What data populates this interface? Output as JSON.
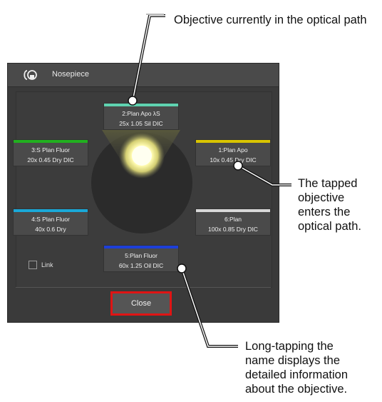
{
  "callouts": {
    "current": "Objective currently in the optical path",
    "tapped_1": "The tapped",
    "tapped_2": "objective",
    "tapped_3": "enters the",
    "tapped_4": "optical path.",
    "long_1": "Long-tapping the",
    "long_2": "name displays the",
    "long_3": "detailed information",
    "long_4": "about the objective."
  },
  "dialog": {
    "title": "Nosepiece",
    "icon": "nosepiece-app-icon",
    "link_label": "Link",
    "link_checked": false,
    "close_label": "Close"
  },
  "objectives": [
    {
      "slot": "2",
      "name": "2:Plan Apo λS",
      "spec": "25x 1.05 Sil DIC",
      "color": "#5fd3b0",
      "in_path": true
    },
    {
      "slot": "3",
      "name": "3:S Plan Fluor",
      "spec": "20x 0.45 Dry DIC",
      "color": "#21b01f"
    },
    {
      "slot": "1",
      "name": "1:Plan Apo",
      "spec": "10x 0.45 Dry DIC",
      "color": "#d9c400"
    },
    {
      "slot": "4",
      "name": "4:S Plan Fluor",
      "spec": "40x 0.6 Dry",
      "color": "#1aa8d8"
    },
    {
      "slot": "6",
      "name": "6:Plan",
      "spec": "100x 0.85 Dry DIC",
      "color": "#d8d8d8"
    },
    {
      "slot": "5",
      "name": "5:Plan Fluor",
      "spec": "60x 1.25 Oil DIC",
      "color": "#1d3fd8"
    }
  ]
}
